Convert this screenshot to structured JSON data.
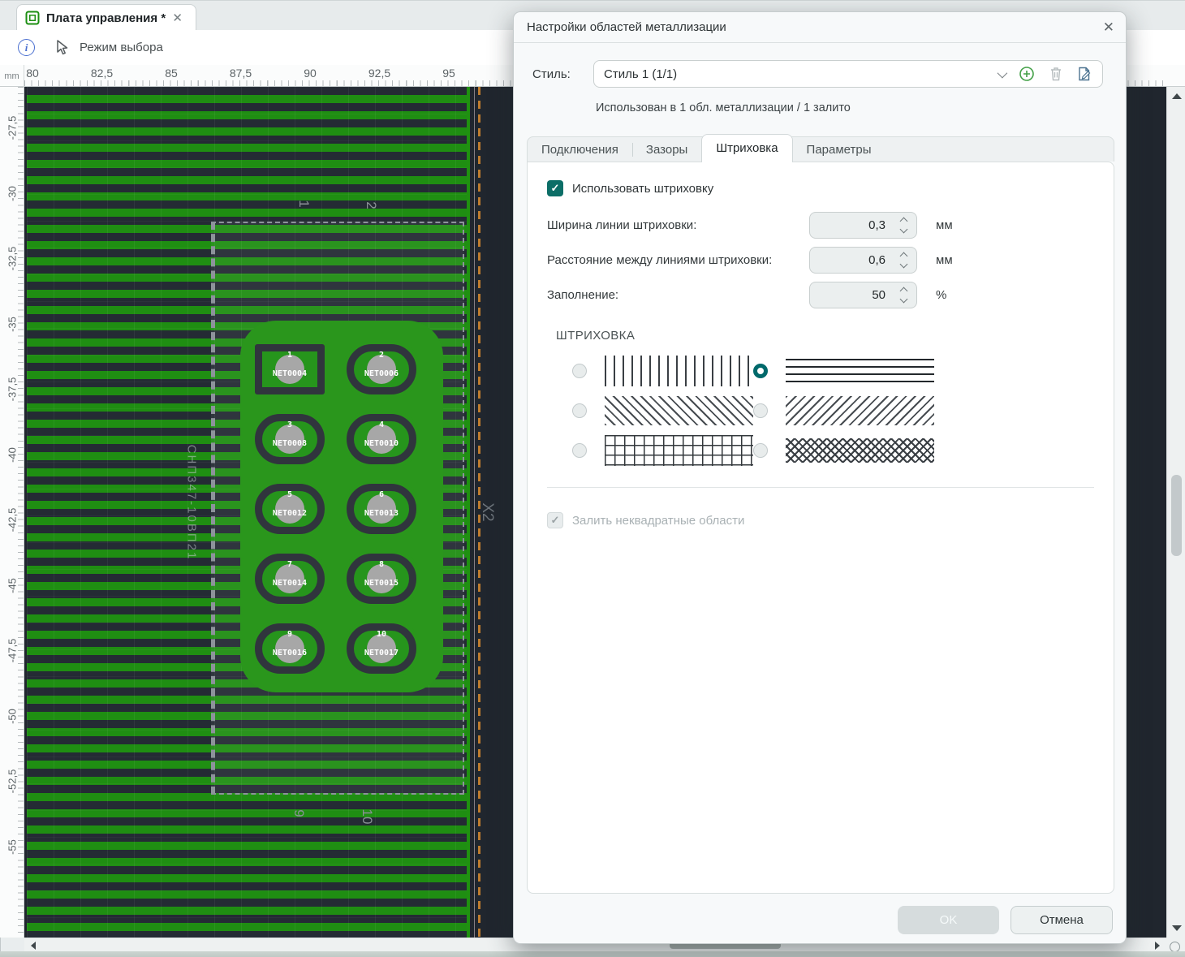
{
  "window": {
    "tab": {
      "title": "Плата управления *",
      "close_glyph": "✕"
    },
    "toolbar": {
      "info_glyph": "i",
      "mode_label": "Режим выбора"
    },
    "rulers": {
      "unit": "mm",
      "top_ticks": [
        "80",
        "82,5",
        "85",
        "87,5",
        "90",
        "92,5",
        "95"
      ],
      "left_ticks": [
        "-27,5",
        "-30",
        "-32,5",
        "-35",
        "-37,5",
        "-40",
        "-42,5",
        "-45",
        "-47,5",
        "-50",
        "-52,5",
        "-55"
      ]
    },
    "canvas": {
      "silkscreen": {
        "top_refs": [
          "1",
          "2"
        ],
        "bottom_refs": [
          "9",
          "10"
        ],
        "part_label": "СНП347-10ВП21",
        "connector_ref": "X2"
      },
      "pads": [
        {
          "num": "1",
          "net": "NET0004",
          "shape": "rect"
        },
        {
          "num": "2",
          "net": "NET0006",
          "shape": "oval"
        },
        {
          "num": "3",
          "net": "NET0008",
          "shape": "oval"
        },
        {
          "num": "4",
          "net": "NET0010",
          "shape": "oval"
        },
        {
          "num": "5",
          "net": "NET0012",
          "shape": "oval"
        },
        {
          "num": "6",
          "net": "NET0013",
          "shape": "oval"
        },
        {
          "num": "7",
          "net": "NET0014",
          "shape": "oval"
        },
        {
          "num": "8",
          "net": "NET0015",
          "shape": "oval"
        },
        {
          "num": "9",
          "net": "NET0016",
          "shape": "oval"
        },
        {
          "num": "10",
          "net": "NET0017",
          "shape": "oval"
        }
      ],
      "colors": {
        "board_green": "#1f8e12",
        "canvas_dark": "#20262e",
        "pad_disc": "#a3a3a3",
        "outline_orange": "#bf7c2e"
      }
    }
  },
  "dialog": {
    "title": "Настройки областей металлизации",
    "close_glyph": "✕",
    "style_row": {
      "label": "Стиль:",
      "value": "Стиль 1 (1/1)"
    },
    "usage": "Использован в 1 обл. металлизации / 1 залито",
    "tabs": [
      {
        "label": "Подключения",
        "active": false
      },
      {
        "label": "Зазоры",
        "active": false
      },
      {
        "label": "Штриховка",
        "active": true
      },
      {
        "label": "Параметры",
        "active": false
      }
    ],
    "use_hatch": {
      "label": "Использовать штриховку",
      "checked": true
    },
    "fields": [
      {
        "label": "Ширина линии штриховки:",
        "value": "0,3",
        "unit": "мм"
      },
      {
        "label": "Расстояние между линиями штриховки:",
        "value": "0,6",
        "unit": "мм"
      },
      {
        "label": "Заполнение:",
        "value": "50",
        "unit": "%"
      }
    ],
    "hatch_section": {
      "title": "ШТРИХОВКА",
      "patterns": [
        {
          "name": "vertical-lines",
          "selected": false
        },
        {
          "name": "horizontal-lines",
          "selected": true
        },
        {
          "name": "diagonal-forward",
          "selected": false
        },
        {
          "name": "diagonal-back",
          "selected": false
        },
        {
          "name": "grid",
          "selected": false
        },
        {
          "name": "cross-diamond",
          "selected": false
        }
      ]
    },
    "fill_nonsquare": {
      "label": "Залить неквадратные области",
      "checked": true,
      "disabled": true
    },
    "buttons": {
      "ok": "OK",
      "cancel": "Отмена"
    },
    "accent_color": "#00696b"
  }
}
